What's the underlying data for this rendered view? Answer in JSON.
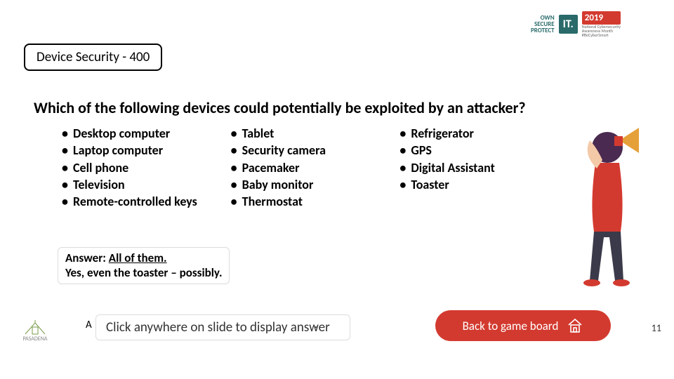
{
  "header": {
    "line1": "OWN",
    "line2": "SECURE",
    "line3": "PROTECT",
    "it": "IT.",
    "year": "2019",
    "tag1": "National Cybersecurity",
    "tag2": "Awareness Month",
    "tag3": "#BeCyberSmart"
  },
  "category": "Device Security - 400",
  "question": "Which of the following devices could potentially be exploited by an attacker?",
  "columns": [
    [
      "Desktop computer",
      "Laptop computer",
      "Cell phone",
      "Television",
      "Remote-controlled keys"
    ],
    [
      "Tablet",
      "Security camera",
      "Pacemaker",
      "Baby monitor",
      "Thermostat"
    ],
    [
      "Refrigerator",
      "GPS",
      "Digital Assistant",
      "Toaster"
    ]
  ],
  "answer": {
    "prefix": "Answer: ",
    "main": "All of them.",
    "line2": "Yes, even the toaster – possibly."
  },
  "hint": {
    "prefix": "A",
    "text": "Click anywhere on slide to display answer",
    "suffix": "."
  },
  "back": "Back to game board",
  "page": "11",
  "corner": "PASADENA"
}
